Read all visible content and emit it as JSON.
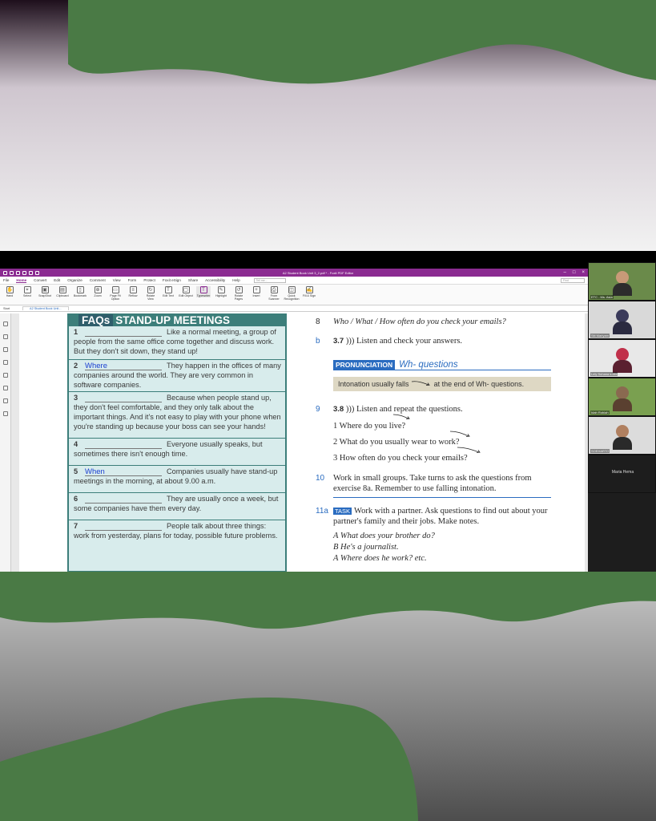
{
  "colors": {
    "green": "#4a7a45",
    "accent": "#8b2b91",
    "teal": "#3c7e7a",
    "blue": "#2a6cc0"
  },
  "app": {
    "title": "A2 Student Book Unit 3_2.pdf * - Foxit PDF Editor",
    "menus": [
      "File",
      "Home",
      "Convert",
      "Edit",
      "Organize",
      "Comment",
      "View",
      "Form",
      "Protect",
      "Foxit eSign",
      "Share",
      "Accessibility",
      "Help"
    ],
    "active_menu": "Home",
    "tell_me": "Tell me...",
    "find": "Find",
    "tools": [
      {
        "label": "Hand",
        "icon": "hand-icon"
      },
      {
        "label": "Select",
        "icon": "cursor-icon"
      },
      {
        "label": "SnapShot",
        "icon": "camera-icon"
      },
      {
        "label": "Clipboard",
        "icon": "clipboard-icon"
      },
      {
        "label": "Bookmark",
        "icon": "bookmark-icon"
      },
      {
        "label": "Zoom",
        "icon": "zoom-icon"
      },
      {
        "label": "Page Fit Option",
        "icon": "page-fit-icon"
      },
      {
        "label": "Reflow",
        "icon": "reflow-icon"
      },
      {
        "label": "Rotate View",
        "icon": "rotate-icon"
      },
      {
        "label": "Edit Text",
        "icon": "edit-text-icon"
      },
      {
        "label": "Edit Object",
        "icon": "edit-object-icon"
      },
      {
        "label": "Typewriter",
        "icon": "typewriter-icon"
      },
      {
        "label": "Highlight",
        "icon": "highlight-icon"
      },
      {
        "label": "Rotate Pages",
        "icon": "rotate-pages-icon"
      },
      {
        "label": "Insert",
        "icon": "insert-icon"
      },
      {
        "label": "From Scanner",
        "icon": "scanner-icon"
      },
      {
        "label": "Quick Recognition",
        "icon": "ocr-icon"
      },
      {
        "label": "Fill & Sign",
        "icon": "sign-icon"
      }
    ],
    "selected_tool": "Typewriter",
    "tab_start": "Start",
    "tab_doc": "A2 Student Book Unit..."
  },
  "faq": {
    "title_a": "FAQs",
    "title_b": "STAND-UP MEETINGS",
    "items": [
      {
        "n": "1",
        "answer": "",
        "text": "Like a normal meeting, a group of people from the same office come together and discuss work. But they don't sit down, they stand up!"
      },
      {
        "n": "2",
        "answer": "Where",
        "text": "They happen in the offices of many companies around the world. They are very common in software companies."
      },
      {
        "n": "3",
        "answer": "",
        "text": "Because when people stand up, they don't feel comfortable, and they only talk about the important things. And it's not easy to play with your phone when you're standing up because your boss can see your hands!"
      },
      {
        "n": "4",
        "answer": "",
        "text": "Everyone usually speaks, but sometimes there isn't enough time."
      },
      {
        "n": "5",
        "answer": "When",
        "text": "Companies usually have stand-up meetings in the morning, at about 9.00 a.m."
      },
      {
        "n": "6",
        "answer": "",
        "text": "They are usually once a week, but some companies have them every day."
      },
      {
        "n": "7",
        "answer": "",
        "text": "People talk about three things: work from yesterday, plans for today, possible future problems."
      }
    ]
  },
  "right": {
    "line8_n": "8",
    "line8": "Who / What / How often do you check your emails?",
    "b_n": "b",
    "b_audio": "3.7",
    "b_text": "Listen and check your answers.",
    "pron_tag": "PRONUNCIATION",
    "pron_sub": "Wh- questions",
    "tip_a": "Intonation usually falls",
    "tip_b": "at the end of Wh- questions.",
    "ex9_n": "9",
    "ex9_audio": "3.8",
    "ex9_text": "Listen and repeat the questions.",
    "q1": "1   Where do you live?",
    "q2": "2   What do you usually wear to work?",
    "q3": "3   How often do you check your emails?",
    "ex10_n": "10",
    "ex10_text": "Work in small groups. Take turns to ask the questions from exercise 8a. Remember to use falling intonation.",
    "ex11_n": "11a",
    "ex11_tag": "TASK",
    "ex11_text": "Work with a partner. Ask questions to find out about your partner's family and their jobs. Make notes.",
    "a_line": "A   What does your brother do?",
    "b_line": "B   He's a journalist.",
    "c_line": "A   Where does he work? etc."
  },
  "participants": [
    {
      "name": "ETC - Ms. Asia"
    },
    {
      "name": "Siti Mariyam"
    },
    {
      "name": "Lely Suhana s.cks"
    },
    {
      "name": "Idah Robiah"
    },
    {
      "name": "SOEHARTO"
    },
    {
      "name": "Maria Hema"
    }
  ]
}
